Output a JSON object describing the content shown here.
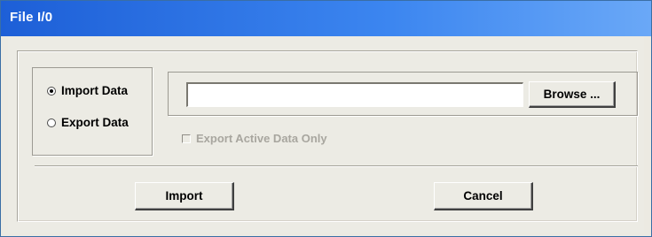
{
  "window": {
    "title": "File I/0"
  },
  "mode_group": {
    "options": [
      {
        "label": "Import Data",
        "selected": true
      },
      {
        "label": "Export Data",
        "selected": false
      }
    ]
  },
  "file": {
    "path_value": "",
    "browse_label": "Browse ..."
  },
  "export_active_only": {
    "label": "Export Active Data Only",
    "checked": false,
    "enabled": false
  },
  "actions": {
    "import_label": "Import",
    "cancel_label": "Cancel"
  },
  "colors": {
    "titlebar_start": "#1d5fd7",
    "titlebar_end": "#6aa8f7",
    "dialog_background": "#ecebe4",
    "disabled_text": "#a8a69f"
  }
}
